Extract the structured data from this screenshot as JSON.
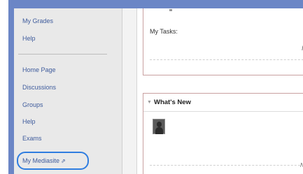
{
  "sidebar": {
    "items_top": [
      {
        "label": "My Grades"
      },
      {
        "label": "Help"
      }
    ],
    "items_bottom": [
      {
        "label": "Home Page"
      },
      {
        "label": "Discussions"
      },
      {
        "label": "Groups"
      },
      {
        "label": "Help"
      },
      {
        "label": "Exams"
      },
      {
        "label": "My Mediasite"
      }
    ],
    "external_link_icon": "external-link-icon",
    "highlight_color": "#2f7de0"
  },
  "main": {
    "tasks_panel": {
      "label": "My Tasks:",
      "cut_text": "I"
    },
    "whats_new_panel": {
      "title": "What's New",
      "chevron_icon": "chevron-down-icon",
      "cut_text": "N"
    }
  },
  "colors": {
    "frame_border": "#6b86c6",
    "link": "#3e5b9c",
    "panel_border": "#c9a0a0"
  }
}
